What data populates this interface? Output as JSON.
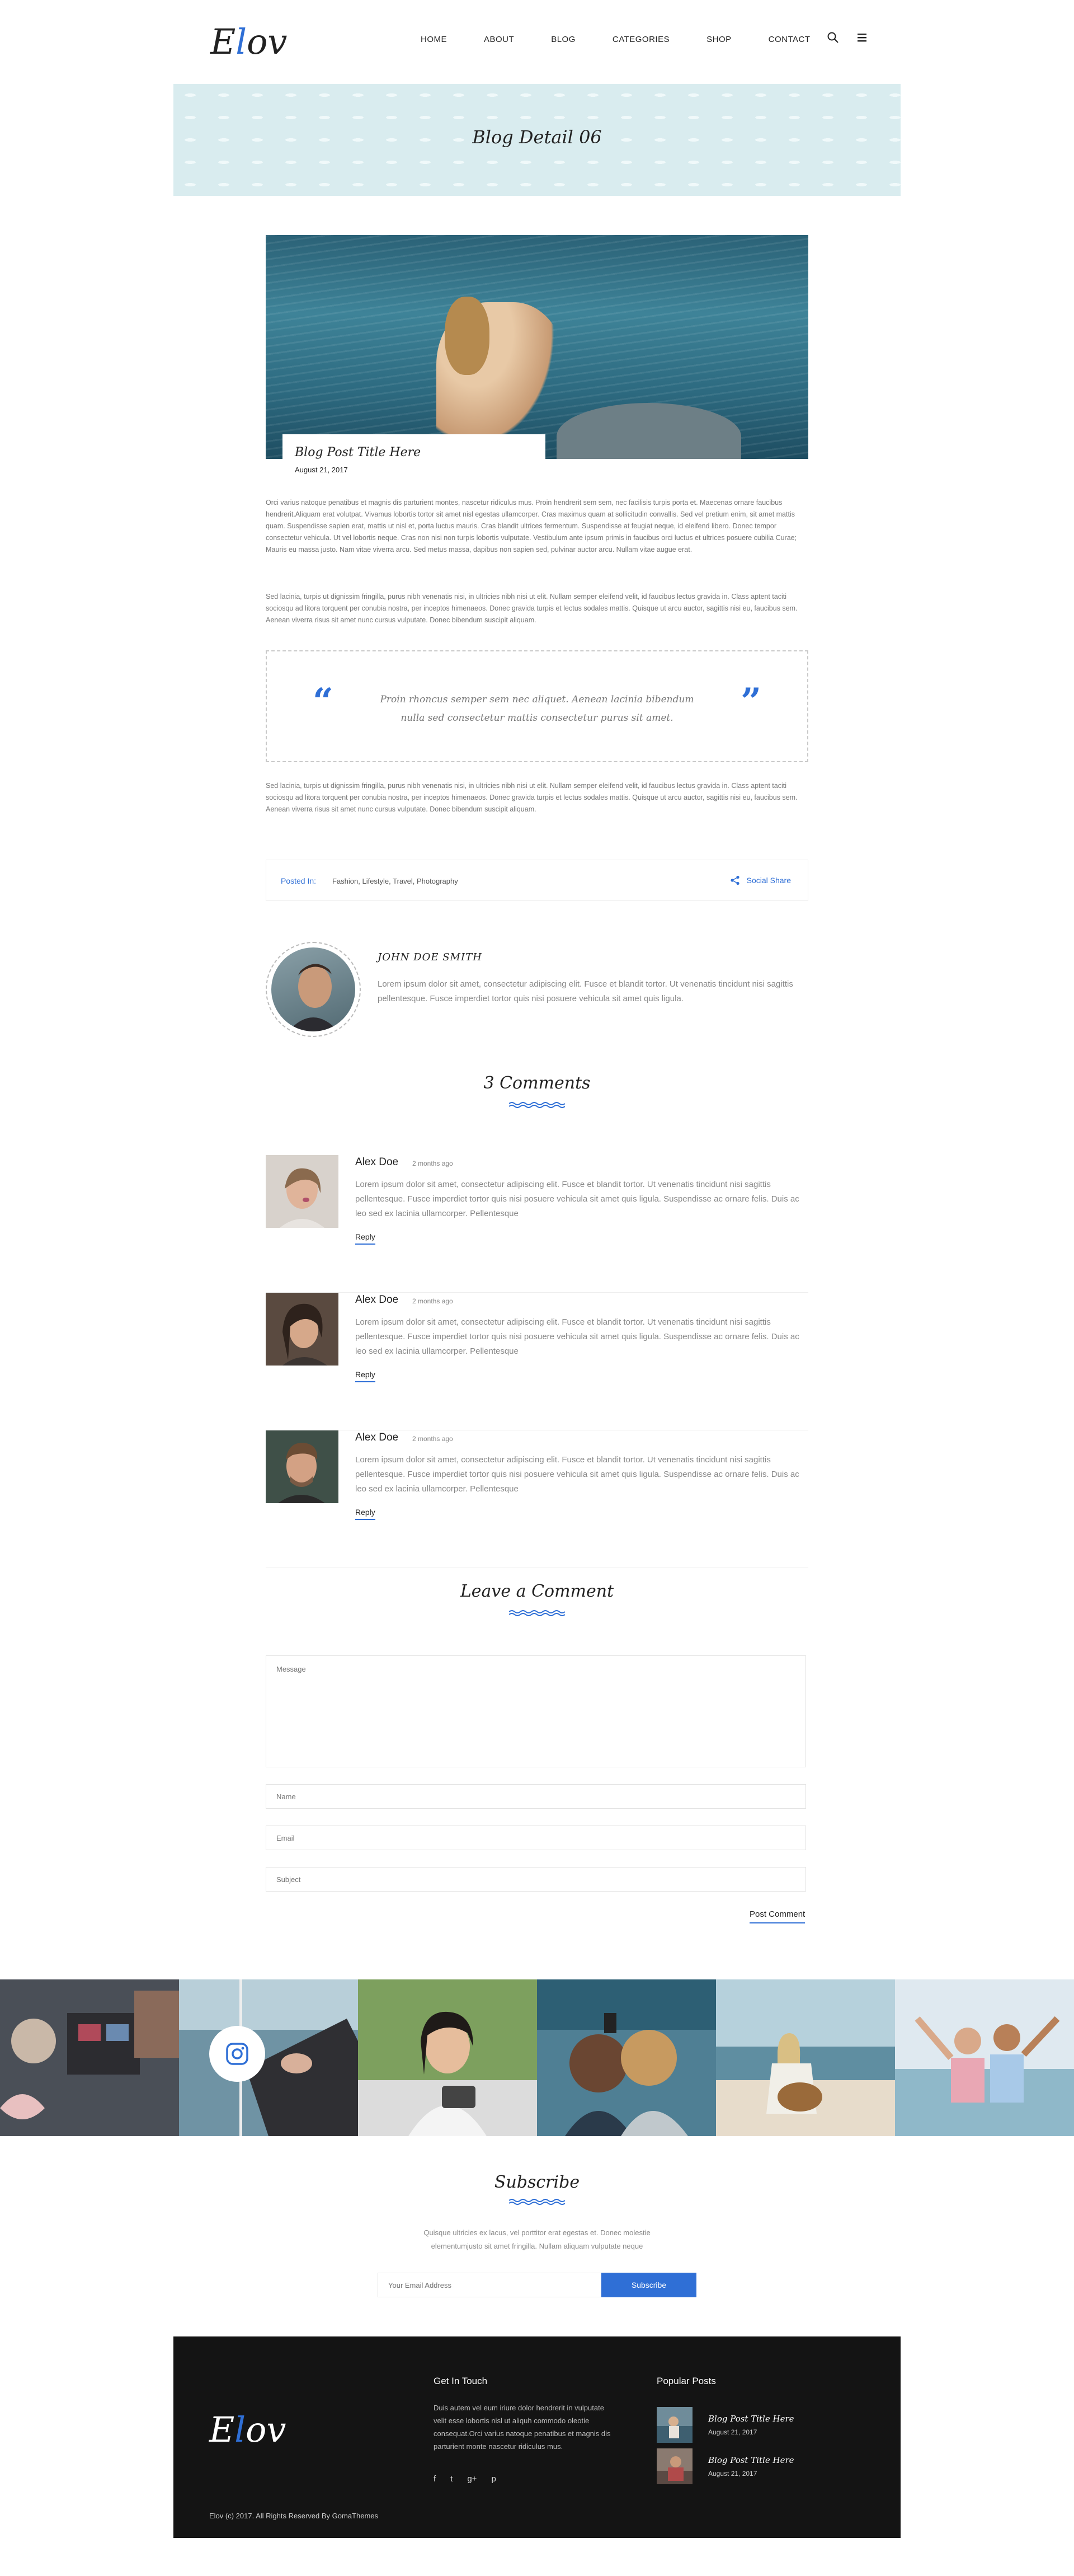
{
  "header": {
    "logo_first": "E",
    "logo_accent": "l",
    "logo_rest": "ov",
    "nav": [
      "HOME",
      "ABOUT",
      "BLOG",
      "CATEGORIES",
      "SHOP",
      "CONTACT"
    ],
    "icons": [
      "search-icon",
      "menu-icon"
    ]
  },
  "banner": {
    "title": "Blog Detail 06"
  },
  "post": {
    "title": "Blog Post Title Here",
    "date": "August 21, 2017",
    "para1": "Orci varius natoque penatibus et magnis dis parturient montes, nascetur ridiculus mus. Proin hendrerit sem sem, nec facilisis turpis porta et. Maecenas ornare faucibus hendrerit.Aliquam erat volutpat. Vivamus lobortis tortor sit amet nisl egestas ullamcorper. Cras maximus quam at sollicitudin convallis. Sed vel pretium enim, sit amet mattis quam. Suspendisse sapien erat, mattis ut nisl et, porta luctus mauris. Cras blandit ultrices fermentum. Suspendisse at feugiat neque, id eleifend libero. Donec tempor consectetur vehicula. Ut vel lobortis neque. Cras non nisi non turpis lobortis vulputate. Vestibulum ante ipsum primis in faucibus orci luctus et ultrices posuere cubilia Curae; Mauris eu massa justo. Nam vitae viverra arcu. Sed metus massa, dapibus non sapien sed, pulvinar auctor arcu. Nullam vitae augue erat.",
    "para2": "Sed lacinia, turpis ut dignissim fringilla, purus nibh venenatis nisi, in ultricies nibh nisi ut elit. Nullam semper eleifend velit, id faucibus lectus gravida in. Class aptent taciti sociosqu ad litora torquent per conubia nostra, per inceptos himenaeos. Donec gravida turpis et lectus sodales mattis. Quisque ut arcu auctor, sagittis nisi eu, faucibus sem. Aenean viverra risus sit amet nunc cursus vulputate. Donec bibendum suscipit aliquam.",
    "quote": "Proin rhoncus semper sem nec aliquet. Aenean lacinia bibendum nulla sed consectetur mattis consectetur purus sit amet.",
    "para3": "Sed lacinia, turpis ut dignissim fringilla, purus nibh venenatis nisi, in ultricies nibh nisi ut elit. Nullam semper eleifend velit, id faucibus lectus gravida in. Class aptent taciti sociosqu ad litora torquent per conubia nostra, per inceptos himenaeos. Donec gravida turpis et lectus sodales mattis. Quisque ut arcu auctor, sagittis nisi eu, faucibus sem. Aenean viverra risus sit amet nunc cursus vulputate. Donec bibendum suscipit aliquam.",
    "posted_in_label": "Posted In:",
    "posted_in_value": "Fashion, Lifestyle, Travel, Photography",
    "share_label": "Social Share"
  },
  "author": {
    "name": "JOHN DOE SMITH",
    "bio": "Lorem ipsum dolor sit amet, consectetur adipiscing elit. Fusce et blandit tortor. Ut venenatis tincidunt nisi sagittis pellentesque. Fusce imperdiet tortor quis nisi posuere vehicula sit amet quis ligula."
  },
  "comments_title": "3 Comments",
  "comments": [
    {
      "name": "Alex Doe",
      "time": "2 months ago",
      "body": "Lorem ipsum dolor sit amet, consectetur adipiscing elit. Fusce et blandit tortor. Ut venenatis tincidunt nisi sagittis pellentesque. Fusce imperdiet tortor quis nisi posuere vehicula sit amet quis ligula. Suspendisse ac ornare felis. Duis ac leo sed ex lacinia ullamcorper. Pellentesque",
      "reply": "Reply"
    },
    {
      "name": "Alex Doe",
      "time": "2 months ago",
      "body": "Lorem ipsum dolor sit amet, consectetur adipiscing elit. Fusce et blandit tortor. Ut venenatis tincidunt nisi sagittis pellentesque. Fusce imperdiet tortor quis nisi posuere vehicula sit amet quis ligula. Suspendisse ac ornare felis. Duis ac leo sed ex lacinia ullamcorper. Pellentesque",
      "reply": "Reply"
    },
    {
      "name": "Alex Doe",
      "time": "2 months ago",
      "body": "Lorem ipsum dolor sit amet, consectetur adipiscing elit. Fusce et blandit tortor. Ut venenatis tincidunt nisi sagittis pellentesque. Fusce imperdiet tortor quis nisi posuere vehicula sit amet quis ligula. Suspendisse ac ornare felis. Duis ac leo sed ex lacinia ullamcorper. Pellentesque",
      "reply": "Reply"
    }
  ],
  "comment_form": {
    "title": "Leave a Comment",
    "message_placeholder": "Message",
    "name_placeholder": "Name",
    "email_placeholder": "Email",
    "subject_placeholder": "Subject",
    "submit": "Post Comment"
  },
  "subscribe": {
    "title": "Subscribe",
    "text": "Quisque ultricies ex lacus, vel porttitor erat egestas et. Donec molestie elementumjusto sit amet fringilla. Nullam aliquam vulputate neque",
    "placeholder": "Your Email Address",
    "button": "Subscribe"
  },
  "footer": {
    "get_in_touch": "Get In Touch",
    "about": "Duis autem vel eum iriure dolor hendrerit in vulputate velit esse lobortis nisl ut aliquh commodo oleotie consequat.Orci varius natoque penatibus et magnis dis parturient monte nascetur ridiculus mus.",
    "socials": [
      "f",
      "t",
      "g+",
      "p"
    ],
    "popular_title": "Popular Posts",
    "popular": [
      {
        "title": "Blog Post Title Here",
        "date": "August 21, 2017"
      },
      {
        "title": "Blog Post Title Here",
        "date": "August 21, 2017"
      }
    ],
    "copyright": "Elov (c) 2017. All Rights Reserved By GomaThemes"
  },
  "colors": {
    "accent": "#2f6fd6",
    "banner": "#d9ecef",
    "footer": "#141414"
  }
}
